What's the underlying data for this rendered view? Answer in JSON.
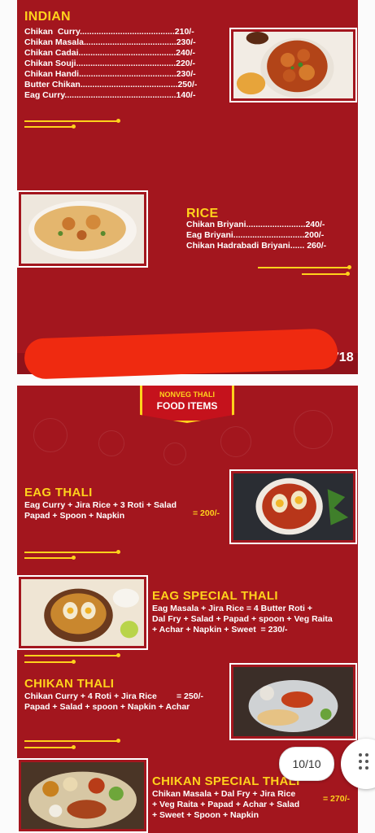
{
  "page1": {
    "indian": {
      "title": "INDIAN",
      "items": [
        "Chikan  Curry........................................210/-",
        "Chikan Masala.......................................230/-",
        "Chikan Cadai.........................................240/-",
        "Chikan Souji..........................................220/-",
        "Chikan Handi.........................................230/-",
        "Butter Chikan.........................................250/-",
        "Eag Curry...............................................140/-"
      ]
    },
    "rice": {
      "title": "RICE",
      "items": [
        "Chikan Briyani.........................240/-",
        "Eag Briyani..............................200/-",
        "Chikan Hadrabadi Briyani...... 260/-"
      ]
    },
    "phone_tail": "7718"
  },
  "page2": {
    "badge_top": "NONVEG THALI",
    "badge_main": "FOOD ITEMS",
    "eag_thali": {
      "title": "EAG THALI",
      "line1": "Eag Curry + Jira Rice + 3 Roti + Salad",
      "line2": "Papad + Spoon + Napkin",
      "price": "= 200/-"
    },
    "eag_special": {
      "title": "EAG SPECIAL THALI",
      "line1": "Eag Masala + Jira Rice = 4 Butter Roti +",
      "line2": "Dal Fry + Salad + Papad + spoon + Veg Raita",
      "line3": "+ Achar + Napkin + Sweet  = 230/-"
    },
    "chikan_thali": {
      "title": "CHIKAN THALI",
      "line1": "Chikan Curry + 4 Roti + Jira Rice",
      "line2": "Papad + Salad + spoon + Napkin + Achar",
      "price": "= 250/-"
    },
    "chikan_special": {
      "title": "CHIKAN SPECIAL THALI",
      "line1": "Chikan Masala + Dal Fry + Jira Rice",
      "line2": "+ Veg Raita + Papad + Achar + Salad",
      "line3": "+ Sweet + Spoon + Napkin",
      "price": "= 270/-"
    }
  },
  "viewer": {
    "page_counter": "10/10",
    "more_icon": "grid-dots-icon"
  },
  "colors": {
    "background": "#a3161e",
    "accent": "#ffd21c",
    "redaction": "#ef2a10"
  }
}
